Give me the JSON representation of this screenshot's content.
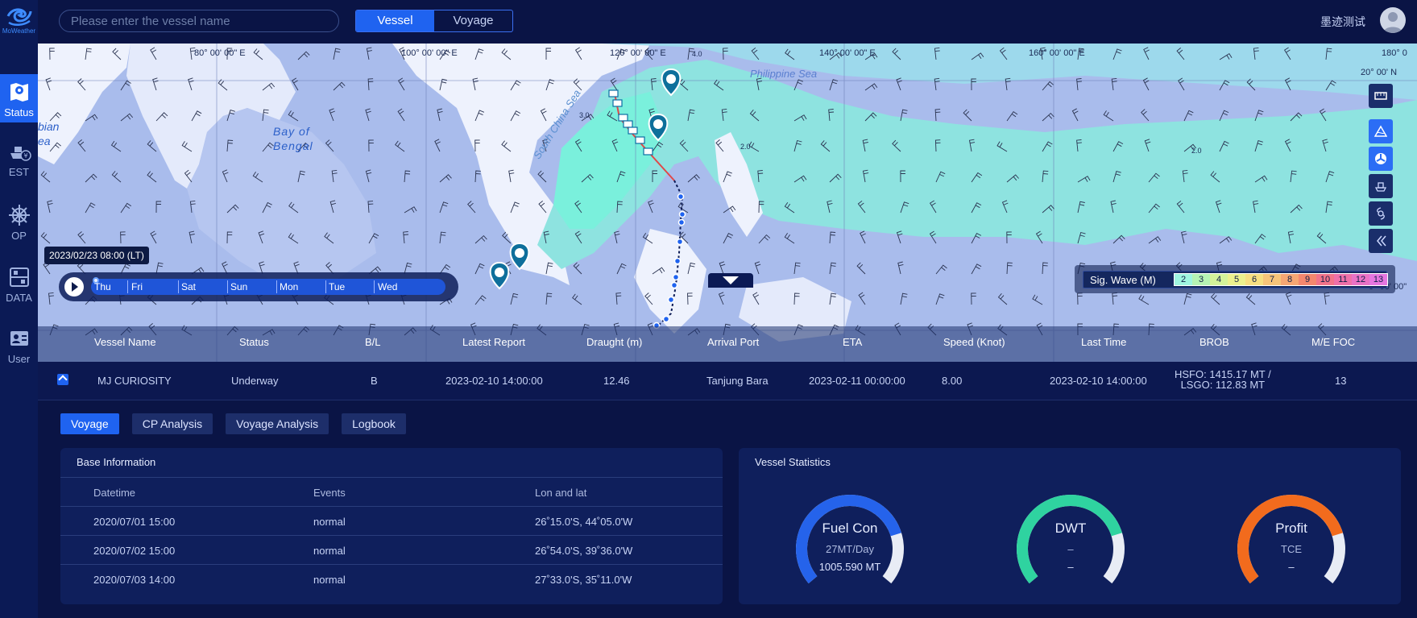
{
  "app": {
    "brand": "MoWeather",
    "user_name": "墨迹测试"
  },
  "search": {
    "placeholder": "Please enter the vessel name",
    "value": ""
  },
  "mode_switch": {
    "options": [
      "Vessel",
      "Voyage"
    ],
    "selected": "Vessel"
  },
  "sidebar": {
    "items": [
      {
        "label": "Status",
        "icon": "map-pin-icon",
        "active": true
      },
      {
        "label": "EST",
        "icon": "ship-dollar-icon",
        "active": false
      },
      {
        "label": "OP",
        "icon": "helm-icon",
        "active": false
      },
      {
        "label": "DATA",
        "icon": "data-icon",
        "active": false
      },
      {
        "label": "User",
        "icon": "user-card-icon",
        "active": false
      }
    ]
  },
  "map": {
    "longitudes": [
      "80° 00' 00\" E",
      "100° 00' 00\" E",
      "120° 00' 00\" E",
      "140° 00' 00\" E",
      "160° 00' 00\" E",
      "180° 0"
    ],
    "latitudes": [
      "20° 00' N",
      "0° 00' 00\""
    ],
    "labels": {
      "bay": "Bay of Bengal",
      "sea_left": "bian ea",
      "philippine": "Philippine Sea",
      "south_china": "South China Sea"
    },
    "wave_labels": [
      "4.0",
      "3.0",
      "2.0",
      "2.0"
    ],
    "time_tooltip": "2023/02/23 08:00 (LT)",
    "timeline_days": [
      "Thu",
      "Fri",
      "Sat",
      "Sun",
      "Mon",
      "Tue",
      "Wed"
    ],
    "wave_legend": {
      "label": "Sig. Wave (M)",
      "steps": [
        "2",
        "3",
        "4",
        "5",
        "6",
        "7",
        "8",
        "9",
        "10",
        "11",
        "12",
        "13"
      ],
      "colors": [
        "#9ff5e0",
        "#b6f3b4",
        "#d4f39a",
        "#ecf08e",
        "#f6de82",
        "#f7c47a",
        "#f6a673",
        "#f4876e",
        "#f2738a",
        "#ef70a9",
        "#ea72c6",
        "#e676e0"
      ]
    },
    "tools": [
      "ruler-icon",
      "wave-triangle-icon",
      "wind-fan-icon",
      "ship-icon",
      "typhoon-icon",
      "collapse-left-icon"
    ]
  },
  "vessel_table": {
    "headers": [
      "Vessel Name",
      "Status",
      "B/L",
      "Latest Report",
      "Draught (m)",
      "Arrival Port",
      "ETA",
      "Speed (Knot)",
      "Last Time",
      "BROB",
      "M/E FOC"
    ],
    "row": {
      "name": "MJ CURIOSITY",
      "status": "Underway",
      "bl": "B",
      "latest_report": "2023-02-10 14:00:00",
      "draught": "12.46",
      "arrival_port": "Tanjung Bara",
      "eta": "2023-02-11 00:00:00",
      "speed": "8.00",
      "last_time": "2023-02-10 14:00:00",
      "brob_line1": "HSFO: 1415.17 MT /",
      "brob_line2": "LSGO: 112.83 MT",
      "me_foc": "13"
    }
  },
  "tabs": [
    {
      "label": "Voyage",
      "active": true
    },
    {
      "label": "CP Analysis",
      "active": false
    },
    {
      "label": "Voyage Analysis",
      "active": false
    },
    {
      "label": "Logbook",
      "active": false
    }
  ],
  "base_info": {
    "title": "Base Information",
    "headers": [
      "Datetime",
      "Events",
      "Lon and lat"
    ],
    "rows": [
      [
        "2020/07/01 15:00",
        "normal",
        "26˚15.0'S, 44˚05.0'W"
      ],
      [
        "2020/07/02 15:00",
        "normal",
        "26˚54.0'S, 39˚36.0'W"
      ],
      [
        "2020/07/03 14:00",
        "normal",
        "27˚33.0'S, 35˚11.0'W"
      ]
    ]
  },
  "stats": {
    "title": "Vessel Statistics",
    "gauges": [
      {
        "title": "Fuel Con",
        "sub": "27MT/Day",
        "value": "1005.590 MT",
        "color": "#2563eb",
        "fraction": 0.78
      },
      {
        "title": "DWT",
        "sub": "–",
        "value": "–",
        "color": "#2fd3a0",
        "fraction": 0.78
      },
      {
        "title": "Profit",
        "sub": "TCE",
        "value": "–",
        "color": "#f26b1d",
        "fraction": 0.78
      }
    ]
  }
}
